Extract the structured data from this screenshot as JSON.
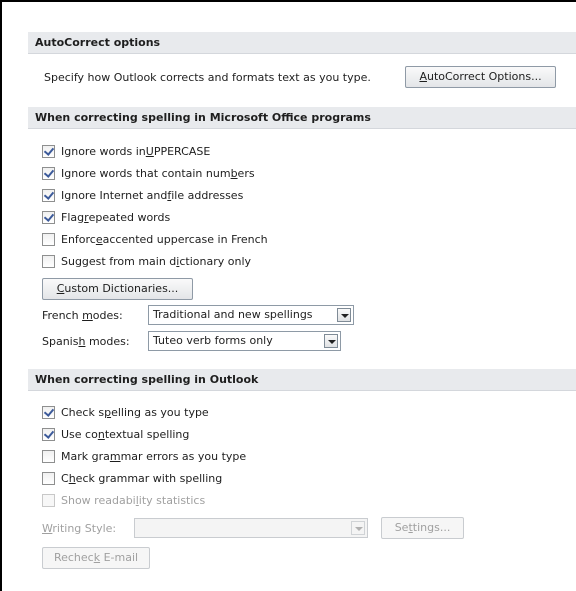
{
  "autocorrect": {
    "header": "AutoCorrect options",
    "description": "Specify how Outlook corrects and formats text as you type.",
    "button_pre": "",
    "button_ul": "A",
    "button_post": "utoCorrect Options..."
  },
  "office": {
    "header": "When correcting spelling in Microsoft Office programs",
    "items": [
      {
        "pre": "Ignore words in ",
        "ul": "U",
        "post": "PPERCASE",
        "checked": true
      },
      {
        "pre": "Ignore words that contain num",
        "ul": "b",
        "post": "ers",
        "checked": true
      },
      {
        "pre": "Ignore Internet and ",
        "ul": "f",
        "post": "ile addresses",
        "checked": true
      },
      {
        "pre": "Flag ",
        "ul": "r",
        "post": "epeated words",
        "checked": true
      },
      {
        "pre": "Enforc",
        "ul": "e",
        "post": " accented uppercase in French",
        "checked": false
      },
      {
        "pre": "Suggest from main d",
        "ul": "i",
        "post": "ctionary only",
        "checked": false
      }
    ],
    "custom_dict_ul": "C",
    "custom_dict_post": "ustom Dictionaries...",
    "french_pre": "French ",
    "french_ul": "m",
    "french_post": "odes:",
    "french_value": "Traditional and new spellings",
    "spanish_pre": "Spanis",
    "spanish_ul": "h",
    "spanish_post": " modes:",
    "spanish_value": "Tuteo verb forms only"
  },
  "outlook": {
    "header": "When correcting spelling in Outlook",
    "items": [
      {
        "pre": "Check s",
        "ul": "p",
        "post": "elling as you type",
        "checked": true,
        "disabled": false
      },
      {
        "pre": "Use co",
        "ul": "n",
        "post": "textual spelling",
        "checked": true,
        "disabled": false
      },
      {
        "pre": "Mark gra",
        "ul": "m",
        "post": "mar errors as you type",
        "checked": false,
        "disabled": false
      },
      {
        "pre": "C",
        "ul": "h",
        "post": "eck grammar with spelling",
        "checked": false,
        "disabled": false
      },
      {
        "pre": "Show readabi",
        "ul": "l",
        "post": "ity statistics",
        "checked": false,
        "disabled": true
      }
    ],
    "writing_style_ul": "W",
    "writing_style_post": "riting Style:",
    "writing_style_value": "",
    "settings_pre": "Se",
    "settings_ul": "t",
    "settings_post": "tings...",
    "recheck_pre": "Rechec",
    "recheck_ul": "k",
    "recheck_post": " E-mail"
  }
}
